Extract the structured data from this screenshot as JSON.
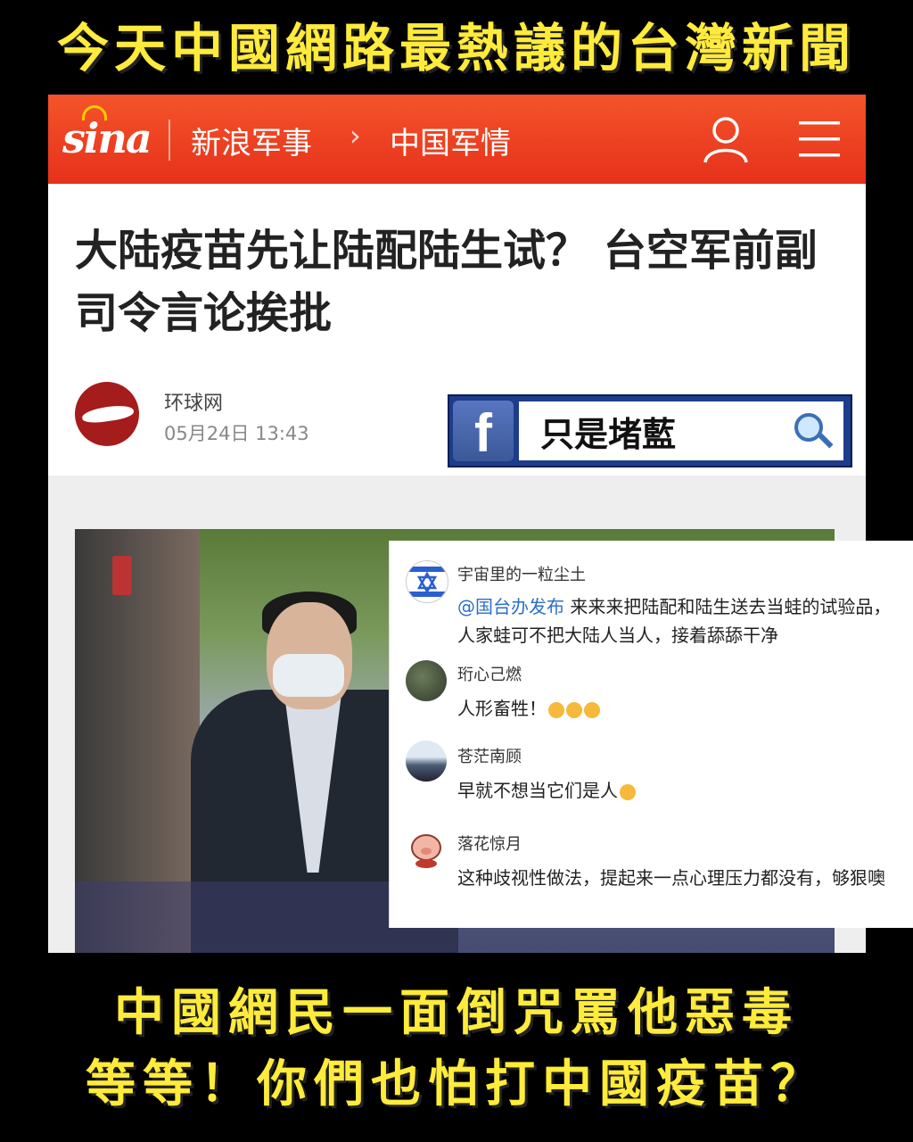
{
  "top_caption": "今天中國網路最熱議的台灣新聞",
  "sina_bar": {
    "logo_text": "sina",
    "breadcrumb_section": "新浪军事",
    "breadcrumb_separator": "›",
    "breadcrumb_subsection": "中国军情",
    "user_icon": "user-icon",
    "menu_icon": "hamburger-menu-icon",
    "bar_color": "#e6311b"
  },
  "article": {
    "headline": "大陆疫苗先让陆配陆生试？ 台空军前副司令言论挨批",
    "source_name": "环球网",
    "timestamp": "05月24日  13:43"
  },
  "fb_tag": {
    "icon_letter": "f",
    "text_main": "只是堵藍",
    "text_highlight": "堵",
    "magnifier_icon": "magnifier-icon"
  },
  "comments": [
    {
      "name": "宇宙里的一粒尘土",
      "mention": "@国台办发布",
      "text": " 来来来把陆配和陆生送去当蛙的试验品，人家蛙可不把大陆人当人，接着舔舔干净"
    },
    {
      "name": "珩心己燃",
      "text": "人形畜牲！"
    },
    {
      "name": "苍茫南顾",
      "text": "早就不想当它们是人"
    },
    {
      "name": "落花惊月",
      "text": "这种歧视性做法，提起来一点心理压力都没有，够狠噢"
    }
  ],
  "bottom_caption": {
    "line1": "中國網民一面倒咒罵他惡毒",
    "line2": "等等！你們也怕打中國疫苗？"
  }
}
